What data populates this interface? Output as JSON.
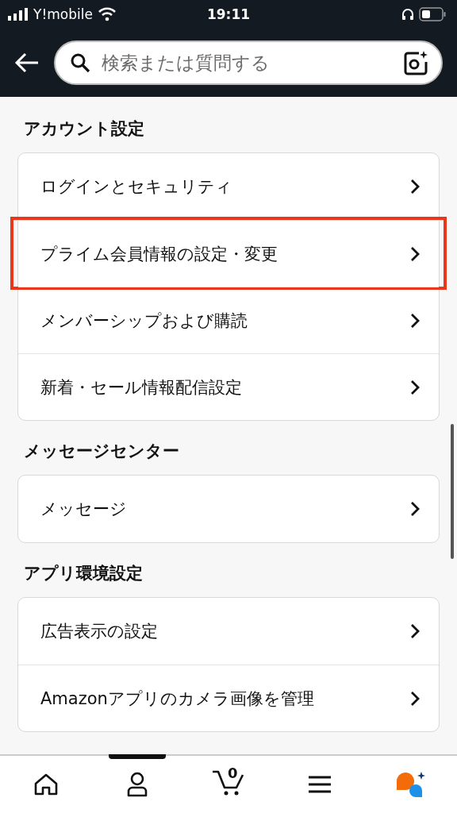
{
  "status_bar": {
    "carrier": "Y!mobile",
    "time": "19:11"
  },
  "search": {
    "placeholder": "検索または質問する"
  },
  "sections": [
    {
      "title": "アカウント設定",
      "items": [
        {
          "label": "ログインとセキュリティ",
          "highlighted": false
        },
        {
          "label": "プライム会員情報の設定・変更",
          "highlighted": true
        },
        {
          "label": "メンバーシップおよび購読",
          "highlighted": false
        },
        {
          "label": "新着・セール情報配信設定",
          "highlighted": false
        }
      ]
    },
    {
      "title": "メッセージセンター",
      "items": [
        {
          "label": "メッセージ",
          "highlighted": false
        }
      ]
    },
    {
      "title": "アプリ環境設定",
      "items": [
        {
          "label": "広告表示の設定",
          "highlighted": false
        },
        {
          "label": "Amazonアプリのカメラ画像を管理",
          "highlighted": false
        }
      ]
    }
  ],
  "bottom_nav": [
    {
      "kind": "home",
      "selected": false
    },
    {
      "kind": "account",
      "selected": true
    },
    {
      "kind": "cart",
      "badge": "0",
      "selected": false
    },
    {
      "kind": "menu",
      "selected": false
    },
    {
      "kind": "assistant",
      "selected": false
    }
  ]
}
